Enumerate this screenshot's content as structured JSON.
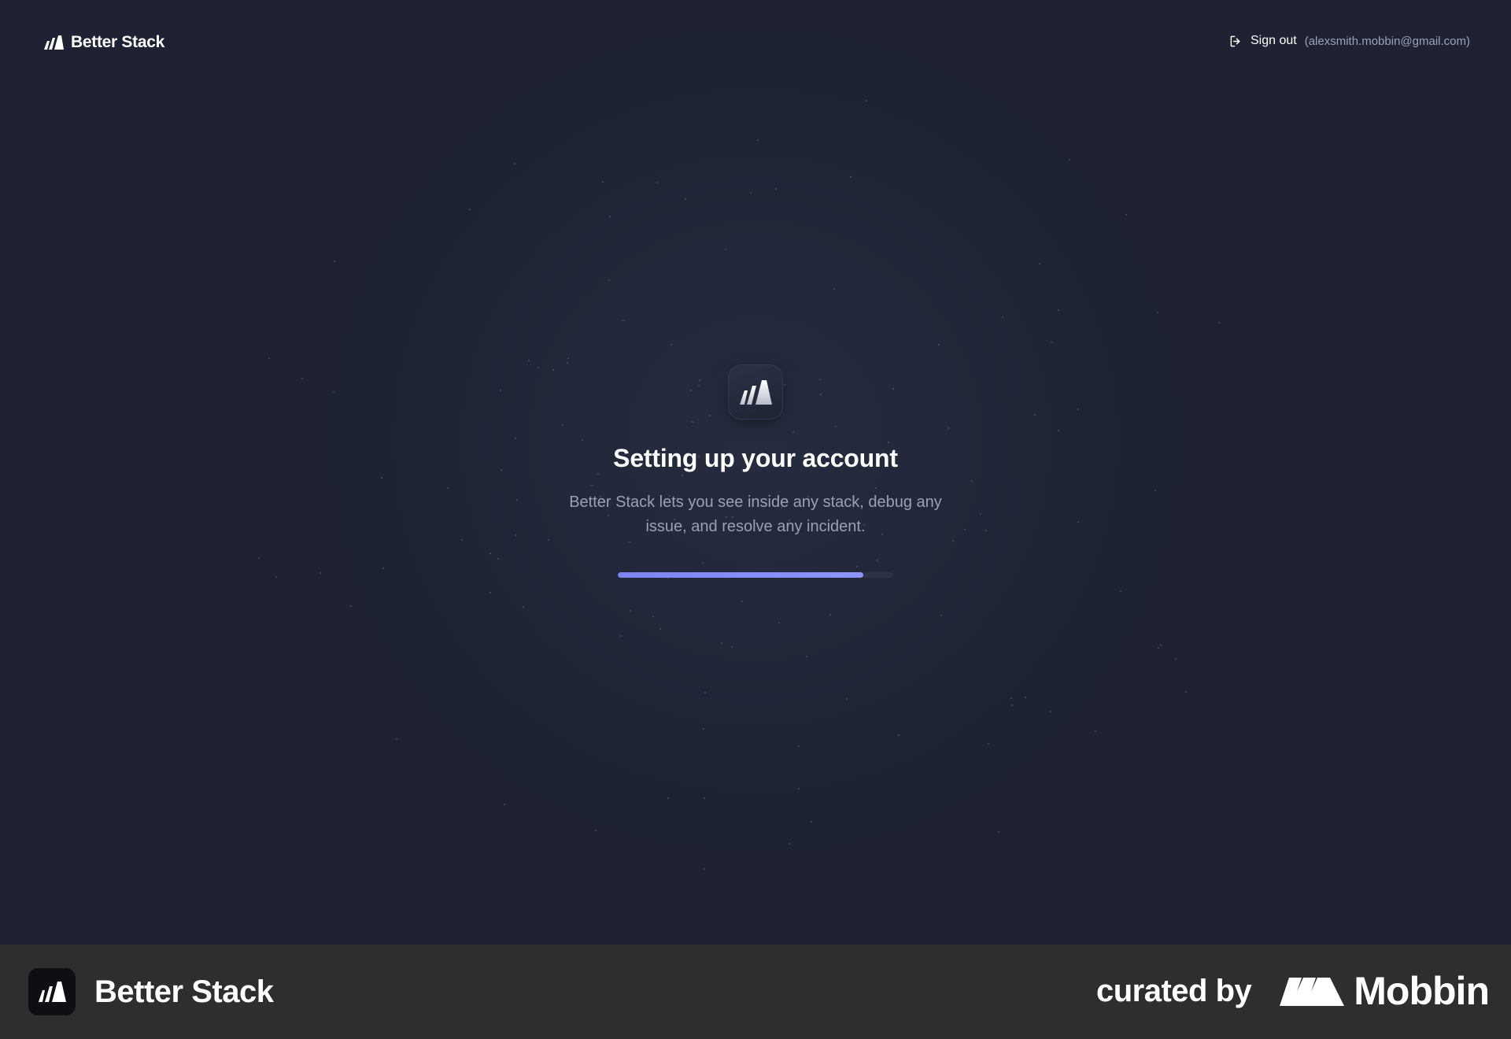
{
  "header": {
    "brand_name": "Better Stack",
    "sign_out_label": "Sign out",
    "sign_out_email": "(alexsmith.mobbin@gmail.com)"
  },
  "main": {
    "title": "Setting up your account",
    "description": "Better Stack lets you see inside any stack, debug any issue, and resolve any incident.",
    "progress_fraction": 0.89,
    "accent_color": "#8088f5"
  },
  "footer": {
    "app_name": "Better Stack",
    "curated_label": "curated by",
    "curator_name": "Mobbin"
  },
  "icons": {
    "brand": "better-stack-logo-icon",
    "sign_out": "sign-out-icon",
    "curator": "mobbin-logo-icon"
  }
}
